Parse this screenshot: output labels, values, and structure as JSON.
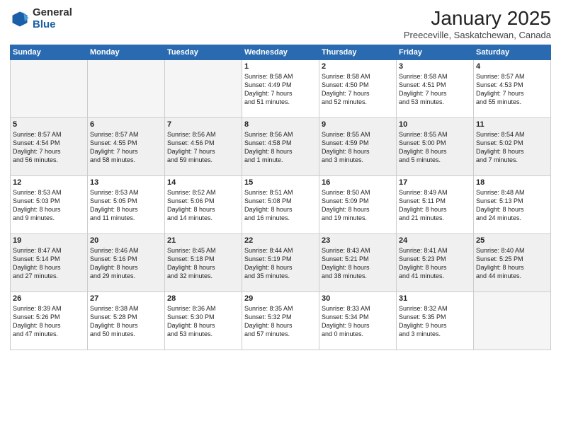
{
  "header": {
    "logo_general": "General",
    "logo_blue": "Blue",
    "title": "January 2025",
    "subtitle": "Preeceville, Saskatchewan, Canada"
  },
  "weekdays": [
    "Sunday",
    "Monday",
    "Tuesday",
    "Wednesday",
    "Thursday",
    "Friday",
    "Saturday"
  ],
  "weeks": [
    [
      {
        "day": "",
        "info": ""
      },
      {
        "day": "",
        "info": ""
      },
      {
        "day": "",
        "info": ""
      },
      {
        "day": "1",
        "info": "Sunrise: 8:58 AM\nSunset: 4:49 PM\nDaylight: 7 hours\nand 51 minutes."
      },
      {
        "day": "2",
        "info": "Sunrise: 8:58 AM\nSunset: 4:50 PM\nDaylight: 7 hours\nand 52 minutes."
      },
      {
        "day": "3",
        "info": "Sunrise: 8:58 AM\nSunset: 4:51 PM\nDaylight: 7 hours\nand 53 minutes."
      },
      {
        "day": "4",
        "info": "Sunrise: 8:57 AM\nSunset: 4:53 PM\nDaylight: 7 hours\nand 55 minutes."
      }
    ],
    [
      {
        "day": "5",
        "info": "Sunrise: 8:57 AM\nSunset: 4:54 PM\nDaylight: 7 hours\nand 56 minutes."
      },
      {
        "day": "6",
        "info": "Sunrise: 8:57 AM\nSunset: 4:55 PM\nDaylight: 7 hours\nand 58 minutes."
      },
      {
        "day": "7",
        "info": "Sunrise: 8:56 AM\nSunset: 4:56 PM\nDaylight: 7 hours\nand 59 minutes."
      },
      {
        "day": "8",
        "info": "Sunrise: 8:56 AM\nSunset: 4:58 PM\nDaylight: 8 hours\nand 1 minute."
      },
      {
        "day": "9",
        "info": "Sunrise: 8:55 AM\nSunset: 4:59 PM\nDaylight: 8 hours\nand 3 minutes."
      },
      {
        "day": "10",
        "info": "Sunrise: 8:55 AM\nSunset: 5:00 PM\nDaylight: 8 hours\nand 5 minutes."
      },
      {
        "day": "11",
        "info": "Sunrise: 8:54 AM\nSunset: 5:02 PM\nDaylight: 8 hours\nand 7 minutes."
      }
    ],
    [
      {
        "day": "12",
        "info": "Sunrise: 8:53 AM\nSunset: 5:03 PM\nDaylight: 8 hours\nand 9 minutes."
      },
      {
        "day": "13",
        "info": "Sunrise: 8:53 AM\nSunset: 5:05 PM\nDaylight: 8 hours\nand 11 minutes."
      },
      {
        "day": "14",
        "info": "Sunrise: 8:52 AM\nSunset: 5:06 PM\nDaylight: 8 hours\nand 14 minutes."
      },
      {
        "day": "15",
        "info": "Sunrise: 8:51 AM\nSunset: 5:08 PM\nDaylight: 8 hours\nand 16 minutes."
      },
      {
        "day": "16",
        "info": "Sunrise: 8:50 AM\nSunset: 5:09 PM\nDaylight: 8 hours\nand 19 minutes."
      },
      {
        "day": "17",
        "info": "Sunrise: 8:49 AM\nSunset: 5:11 PM\nDaylight: 8 hours\nand 21 minutes."
      },
      {
        "day": "18",
        "info": "Sunrise: 8:48 AM\nSunset: 5:13 PM\nDaylight: 8 hours\nand 24 minutes."
      }
    ],
    [
      {
        "day": "19",
        "info": "Sunrise: 8:47 AM\nSunset: 5:14 PM\nDaylight: 8 hours\nand 27 minutes."
      },
      {
        "day": "20",
        "info": "Sunrise: 8:46 AM\nSunset: 5:16 PM\nDaylight: 8 hours\nand 29 minutes."
      },
      {
        "day": "21",
        "info": "Sunrise: 8:45 AM\nSunset: 5:18 PM\nDaylight: 8 hours\nand 32 minutes."
      },
      {
        "day": "22",
        "info": "Sunrise: 8:44 AM\nSunset: 5:19 PM\nDaylight: 8 hours\nand 35 minutes."
      },
      {
        "day": "23",
        "info": "Sunrise: 8:43 AM\nSunset: 5:21 PM\nDaylight: 8 hours\nand 38 minutes."
      },
      {
        "day": "24",
        "info": "Sunrise: 8:41 AM\nSunset: 5:23 PM\nDaylight: 8 hours\nand 41 minutes."
      },
      {
        "day": "25",
        "info": "Sunrise: 8:40 AM\nSunset: 5:25 PM\nDaylight: 8 hours\nand 44 minutes."
      }
    ],
    [
      {
        "day": "26",
        "info": "Sunrise: 8:39 AM\nSunset: 5:26 PM\nDaylight: 8 hours\nand 47 minutes."
      },
      {
        "day": "27",
        "info": "Sunrise: 8:38 AM\nSunset: 5:28 PM\nDaylight: 8 hours\nand 50 minutes."
      },
      {
        "day": "28",
        "info": "Sunrise: 8:36 AM\nSunset: 5:30 PM\nDaylight: 8 hours\nand 53 minutes."
      },
      {
        "day": "29",
        "info": "Sunrise: 8:35 AM\nSunset: 5:32 PM\nDaylight: 8 hours\nand 57 minutes."
      },
      {
        "day": "30",
        "info": "Sunrise: 8:33 AM\nSunset: 5:34 PM\nDaylight: 9 hours\nand 0 minutes."
      },
      {
        "day": "31",
        "info": "Sunrise: 8:32 AM\nSunset: 5:35 PM\nDaylight: 9 hours\nand 3 minutes."
      },
      {
        "day": "",
        "info": ""
      }
    ]
  ]
}
